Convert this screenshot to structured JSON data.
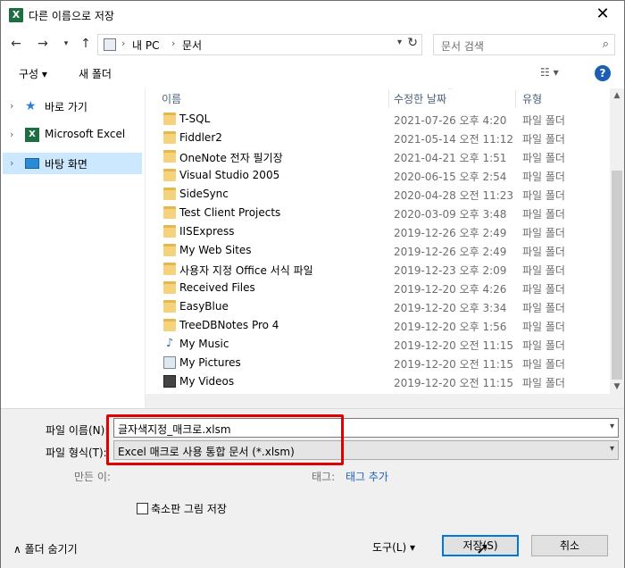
{
  "window": {
    "title": "다른 이름으로 저장",
    "app_icon": "X",
    "close": "✕"
  },
  "address": {
    "segments": [
      "내 PC",
      "문서"
    ],
    "search_placeholder": "문서 검색"
  },
  "toolbar": {
    "organize": "구성 ▾",
    "new_folder": "새 폴더",
    "view": "☷ ▾",
    "help": "?"
  },
  "nav": {
    "items": [
      {
        "label": "바로 가기"
      },
      {
        "label": "Microsoft Excel"
      },
      {
        "label": "바탕 화면"
      }
    ]
  },
  "columns": {
    "name": "이름",
    "date": "수정한 날짜",
    "type": "유형"
  },
  "files": [
    {
      "name": "T-SQL",
      "date": "2021-07-26 오후 4:20",
      "type": "파일 폴더",
      "icon": "folder"
    },
    {
      "name": "Fiddler2",
      "date": "2021-05-14 오전 11:12",
      "type": "파일 폴더",
      "icon": "folder"
    },
    {
      "name": "OneNote 전자 필기장",
      "date": "2021-04-21 오후 1:51",
      "type": "파일 폴더",
      "icon": "folder"
    },
    {
      "name": "Visual Studio 2005",
      "date": "2020-06-15 오후 2:54",
      "type": "파일 폴더",
      "icon": "folder"
    },
    {
      "name": "SideSync",
      "date": "2020-04-28 오전 11:23",
      "type": "파일 폴더",
      "icon": "folder"
    },
    {
      "name": "Test Client Projects",
      "date": "2020-03-09 오후 3:48",
      "type": "파일 폴더",
      "icon": "folder"
    },
    {
      "name": "IISExpress",
      "date": "2019-12-26 오후 2:49",
      "type": "파일 폴더",
      "icon": "folder"
    },
    {
      "name": "My Web Sites",
      "date": "2019-12-26 오후 2:49",
      "type": "파일 폴더",
      "icon": "folder"
    },
    {
      "name": "사용자 지정 Office 서식 파일",
      "date": "2019-12-23 오후 2:09",
      "type": "파일 폴더",
      "icon": "folder"
    },
    {
      "name": "Received Files",
      "date": "2019-12-20 오후 4:26",
      "type": "파일 폴더",
      "icon": "folder"
    },
    {
      "name": "EasyBlue",
      "date": "2019-12-20 오후 3:34",
      "type": "파일 폴더",
      "icon": "folder"
    },
    {
      "name": "TreeDBNotes Pro 4",
      "date": "2019-12-20 오후 1:56",
      "type": "파일 폴더",
      "icon": "folder"
    },
    {
      "name": "My Music",
      "date": "2019-12-20 오전 11:15",
      "type": "파일 폴더",
      "icon": "music"
    },
    {
      "name": "My Pictures",
      "date": "2019-12-20 오전 11:15",
      "type": "파일 폴더",
      "icon": "pictures"
    },
    {
      "name": "My Videos",
      "date": "2019-12-20 오전 11:15",
      "type": "파일 폴더",
      "icon": "videos"
    }
  ],
  "form": {
    "filename_label": "파일 이름(N):",
    "filename_value": "글자색지정_매크로.xlsm",
    "filetype_label": "파일 형식(T):",
    "filetype_value": "Excel 매크로 사용 통합 문서 (*.xlsm)",
    "author_label": "만든 이:",
    "tags_label": "태그:",
    "tags_link": "태그 추가",
    "thumbnail_label": "축소판 그림 저장"
  },
  "footer": {
    "hide_folders": "∧ 폴더 숨기기",
    "tools": "도구(L) ▾",
    "save": "저장(S)",
    "cancel": "취소"
  }
}
